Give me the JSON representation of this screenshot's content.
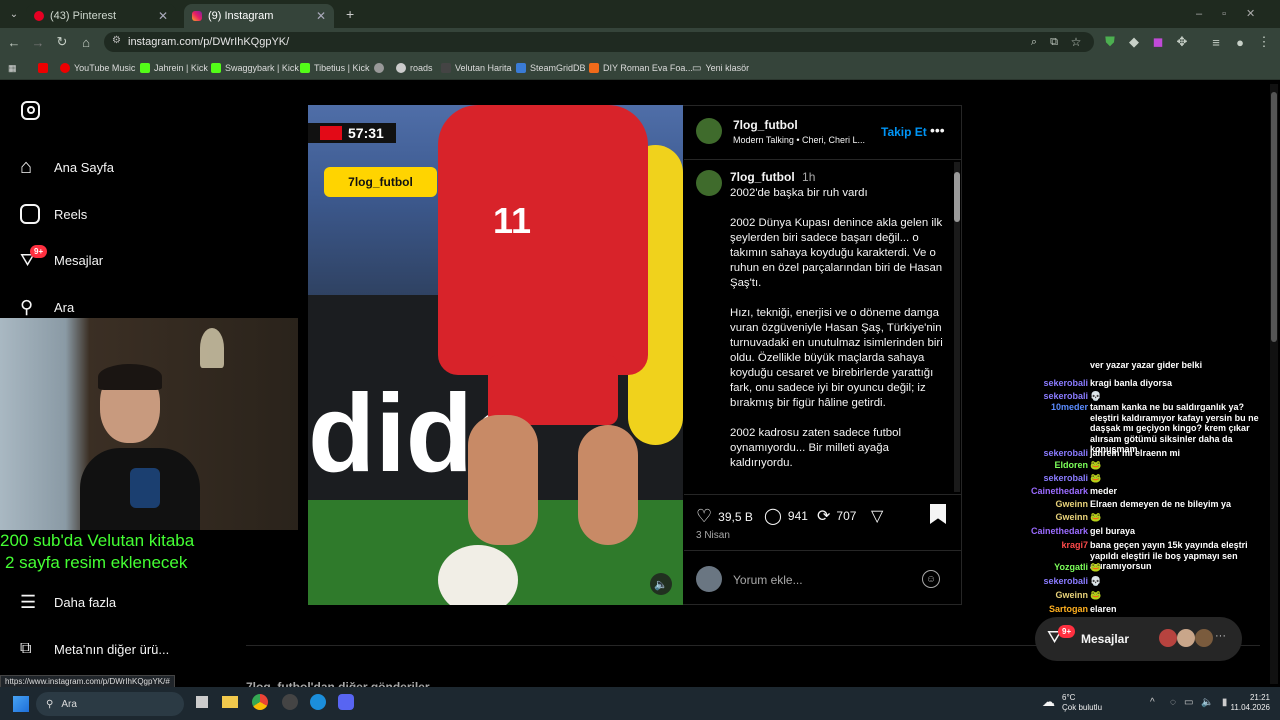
{
  "tabs": [
    {
      "label": "(43) Pinterest",
      "icon": "pinterest-icon",
      "active": false
    },
    {
      "label": "(9) Instagram",
      "icon": "instagram-icon",
      "active": true
    }
  ],
  "address": {
    "url": "instagram.com/p/DWrIhKQgpYK/"
  },
  "bookmarks": [
    "YouTube Music",
    "Jahrein | Kick",
    "Swaggybark | Kick",
    "Tibetius | Kick",
    "roads",
    "Velutan Harita",
    "SteamGridDB",
    "DIY Roman Eva Foa...",
    "Yeni klasör"
  ],
  "sidebar": {
    "items": [
      {
        "label": "Ana Sayfa",
        "icon": "home-icon"
      },
      {
        "label": "Reels",
        "icon": "reels-icon"
      },
      {
        "label": "Mesajlar",
        "icon": "messenger-icon"
      },
      {
        "label": "Ara",
        "icon": "search-icon"
      },
      {
        "label": "Daha fazla",
        "icon": "menu-icon"
      },
      {
        "label": "Meta'nın diğer ürü...",
        "icon": "meta-grid-icon"
      }
    ],
    "badge": "9+"
  },
  "overlay": {
    "line1": "200 sub'da Velutan kitaba",
    "line2": "2 sayfa resim eklenecek"
  },
  "post": {
    "scoreboard": {
      "time": "57:31"
    },
    "sticker": "7log_futbol",
    "player_number": "11",
    "header": {
      "username": "7log_futbol",
      "audio": "Modern Talking • Cheri, Cheri L...",
      "follow": "Takip Et"
    },
    "caption": {
      "username": "7log_futbol",
      "time": "1h",
      "paragraphs": [
        "2002'de başka bir ruh vardı",
        "2002 Dünya Kupası denince akla gelen ilk şeylerden biri sadece başarı değil... o takımın sahaya koyduğu karakterdi. Ve o ruhun en özel parçalarından biri de Hasan Şaş'tı.",
        "Hızı, tekniği, enerjisi ve o döneme damga vuran özgüveniyle Hasan Şaş, Türkiye'nin turnuvadaki en unutulmaz isimlerinden biri oldu. Özellikle büyük maçlarda sahaya koyduğu cesaret ve birebirlerde yarattığı fark, onu sadece iyi bir oyuncu değil; iz bırakmış bir figür hâline getirdi.",
        "2002 kadrosu zaten sadece futbol oynamıyordu... Bir milleti ayağa kaldırıyordu."
      ]
    },
    "likes": "39,5 B",
    "comments": "941",
    "reposts": "707",
    "date": "3 Nisan",
    "comment_placeholder": "Yorum ekle...",
    "more_posts": "7log_futbol'dan diğer gönderiler"
  },
  "messages_widget": {
    "label": "Mesajlar",
    "badge": "9+"
  },
  "chat": [
    {
      "user": "",
      "color": "#ffffff",
      "msg": "ver yazar yazar gider belki"
    },
    {
      "user": "sekerobali",
      "color": "#8a7bff",
      "msg": "kragi banla diyorsa"
    },
    {
      "user": "sekerobali",
      "color": "#8a7bff",
      "msg": "💀"
    },
    {
      "user": "10meder",
      "color": "#5b8cff",
      "msg": "tamam kanka ne bu saldırganlık ya? eleştiri kaldıramıyor kafayı yersin bu ne daşşak mı geçiyon kingo? krem çıkar alırsam götümü siksinler daha da konuşmam"
    },
    {
      "user": "sekerobali",
      "color": "#8a7bff",
      "msg": "jahrein mi elraenn mi"
    },
    {
      "user": "Eldoren",
      "color": "#7cff5a",
      "msg": "🐸"
    },
    {
      "user": "sekerobali",
      "color": "#8a7bff",
      "msg": "🐸"
    },
    {
      "user": "Cainethedark",
      "color": "#9a6bff",
      "msg": "meder"
    },
    {
      "user": "Gweinn",
      "color": "#e8d27a",
      "msg": "Elraen demeyen de ne bileyim ya"
    },
    {
      "user": "Gweinn",
      "color": "#e8d27a",
      "msg": "🐸"
    },
    {
      "user": "Cainethedark",
      "color": "#9a6bff",
      "msg": "gel buraya"
    },
    {
      "user": "kragi7",
      "color": "#ff4a4a",
      "msg": "bana geçen yayın 15k yayında eleştri yapıldı eleştiri ile boş yapmayı sen ayıramıyorsun"
    },
    {
      "user": "Yozgatli",
      "color": "#7cff5a",
      "msg": "🐸"
    },
    {
      "user": "sekerobali",
      "color": "#8a7bff",
      "msg": "💀"
    },
    {
      "user": "Gweinn",
      "color": "#e8d27a",
      "msg": "🐸"
    },
    {
      "user": "Sartogan",
      "color": "#ffb020",
      "msg": "elaren"
    }
  ],
  "statusbar": {
    "url": "https://www.instagram.com/p/DWrIhKQgpYK/#"
  },
  "taskbar": {
    "search": "Ara",
    "weather_temp": "6°C",
    "weather_desc": "Çok bulutlu",
    "time": "21:21",
    "date": "11.04.2026"
  },
  "colors": {
    "accent": "#0095f6",
    "chat_green": "#44ff33",
    "badge": "#ff3040"
  }
}
